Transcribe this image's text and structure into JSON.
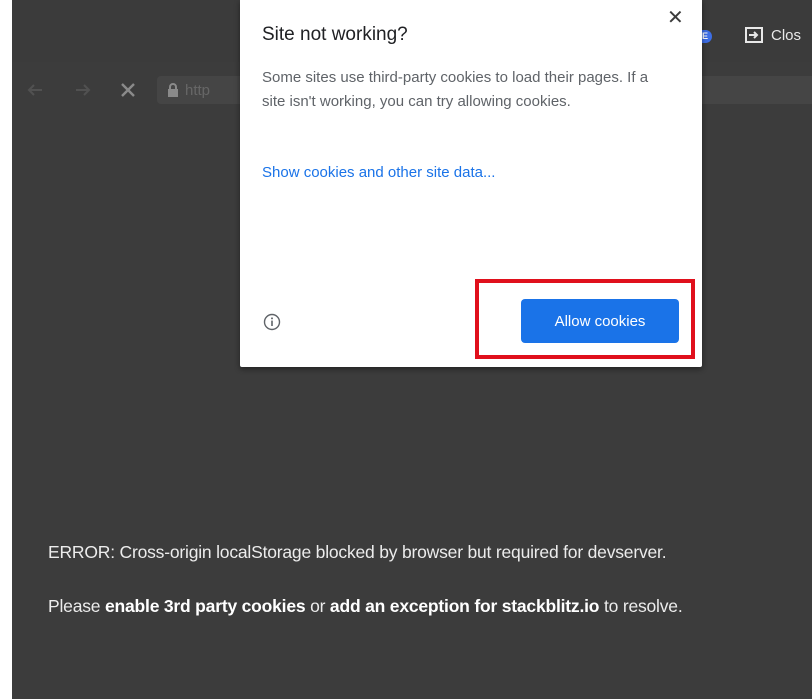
{
  "title_bar": {
    "live_badge": "IVE",
    "close_label": "Clos"
  },
  "toolbar": {
    "url": "http",
    "icons": [
      "back-arrow-icon",
      "forward-arrow-icon",
      "stop-loading-icon",
      "lock-icon"
    ]
  },
  "popup": {
    "title": "Site not working?",
    "close": "✕",
    "body": "Some sites use third-party cookies to load their pages. If a site isn't working, you can try allowing cookies.",
    "link": "Show cookies and other site data...",
    "allow_button": "Allow cookies",
    "icons": [
      "close-icon",
      "info-icon"
    ]
  },
  "content": {
    "error_line_1": "ERROR: Cross-origin localStorage blocked by browser but required for devserver.",
    "line2_part1": "Please ",
    "line2_bold1": "enable 3rd party cookies",
    "line2_part2": " or ",
    "line2_bold2": "add an exception for stackblitz.io",
    "line2_part3": " to resolve."
  },
  "colors": {
    "page_bg": "#3c3c3c",
    "accent": "#1a73e8",
    "highlight": "#e0101c"
  }
}
